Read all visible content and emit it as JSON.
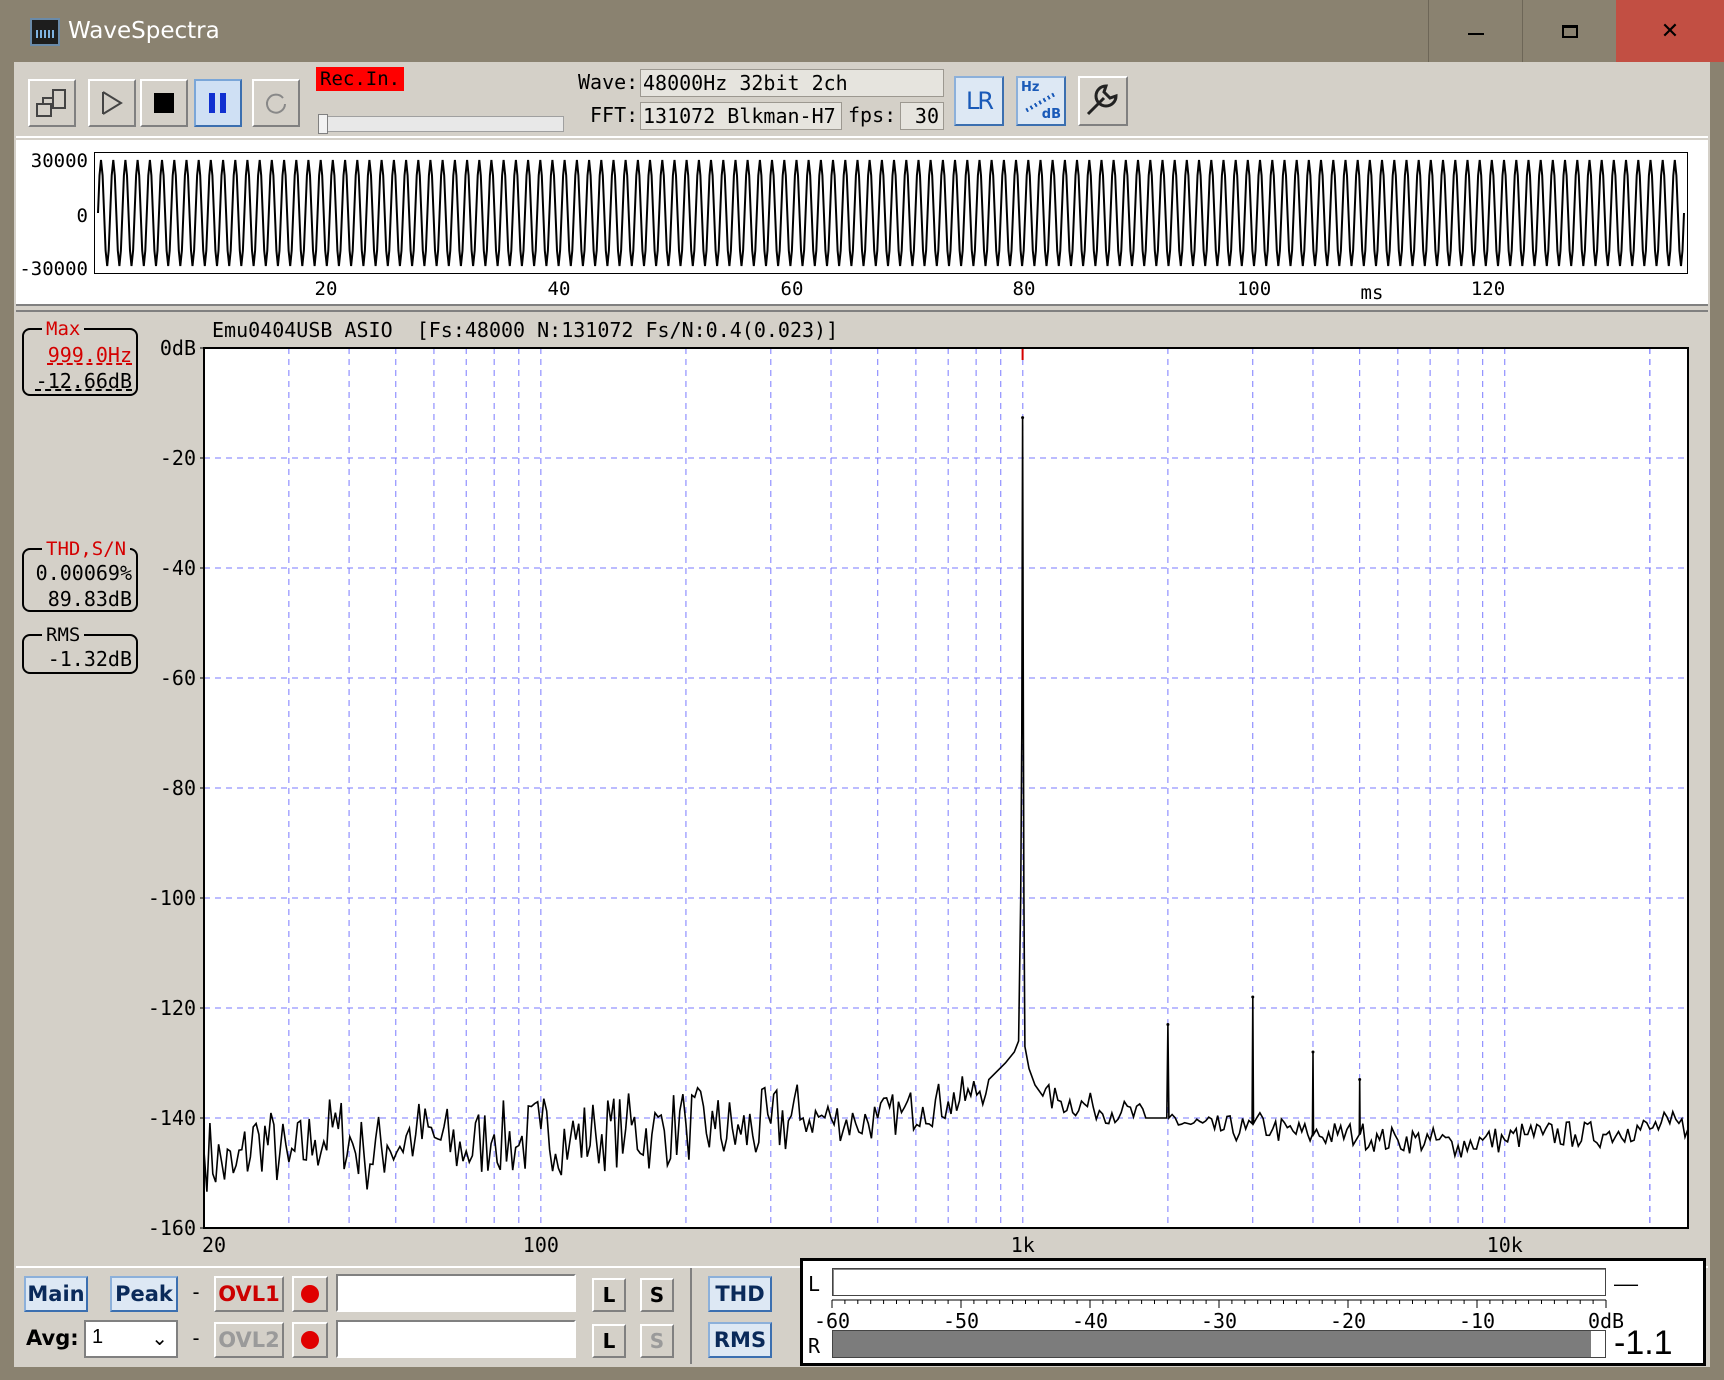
{
  "window": {
    "title": "WaveSpectra",
    "controls": {
      "minimize": "‒",
      "maximize": "▫",
      "close": "✕"
    }
  },
  "toolbar": {
    "rec_in_label": "Rec.In.",
    "wave_label": "Wave:",
    "wave_value": "48000Hz 32bit 2ch",
    "fft_label": "FFT:",
    "fft_value": "131072 Blkman-H7",
    "fps_label": "fps:",
    "fps_value": "30",
    "lr_icon_text": "LR",
    "hz_icon_top": "Hz",
    "hz_icon_bottom": "dB"
  },
  "waveform": {
    "y_labels": [
      "30000",
      "0",
      "-30000"
    ],
    "x_labels": [
      "20",
      "40",
      "60",
      "80",
      "100",
      "120"
    ],
    "x_unit": "ms",
    "cycles_visible": 130
  },
  "spectrum": {
    "header": "Emu0404USB ASIO  [Fs:48000 N:131072 Fs/N:0.4(0.023)]",
    "max_box": {
      "caption": "Max",
      "freq": "999.0Hz",
      "level": "-12.66dB"
    },
    "thd_box": {
      "caption": "THD,S/N",
      "thd": "0.00069%",
      "sn": "89.83dB"
    },
    "rms_box": {
      "caption": "RMS",
      "level": "-1.32dB"
    }
  },
  "chart_data": {
    "type": "line",
    "xlabel": "",
    "ylabel": "",
    "x_scale": "log",
    "xlim": [
      20,
      24000
    ],
    "ylim": [
      -160,
      0
    ],
    "y_ticks": [
      "0dB",
      "-20",
      "-40",
      "-60",
      "-80",
      "-100",
      "-120",
      "-140",
      "-160"
    ],
    "x_ticks": [
      "20",
      "100",
      "1k",
      "10k"
    ],
    "grid": true,
    "series": [
      {
        "x": [
          20,
          23,
          26,
          30,
          34,
          38,
          43,
          48,
          55,
          62,
          70,
          80,
          90,
          100,
          115,
          130,
          150,
          170,
          200,
          230,
          260,
          300,
          350,
          400,
          450,
          500,
          560,
          620,
          700,
          780,
          850,
          920,
          960,
          980,
          990,
          995,
          997,
          999,
          1001,
          1003,
          1005,
          1010,
          1030,
          1060,
          1100,
          1200,
          1400,
          1600,
          1800,
          1990,
          2000,
          2010,
          2200,
          2500,
          2900,
          2990,
          3000,
          3010,
          3300,
          3900,
          3990,
          4000,
          4010,
          4500,
          4990,
          5000,
          5010,
          5500,
          6000,
          7000,
          8000,
          9000,
          10000,
          11000,
          12000,
          14000,
          16000,
          18000,
          20000,
          22000,
          24000
        ],
        "y": [
          -146,
          -150,
          -143,
          -148,
          -144,
          -142,
          -147,
          -145,
          -143,
          -144,
          -146,
          -143,
          -145,
          -142,
          -144,
          -143,
          -142,
          -143,
          -141,
          -142,
          -143,
          -141,
          -140,
          -140,
          -141,
          -140,
          -139,
          -138,
          -137,
          -136,
          -133,
          -130,
          -128,
          -126,
          -100,
          -70,
          -40,
          -12.66,
          -40,
          -70,
          -100,
          -127,
          -131,
          -134,
          -136,
          -137,
          -138,
          -139,
          -140,
          -140,
          -123,
          -140,
          -141,
          -142,
          -142,
          -141,
          -118,
          -141,
          -142,
          -143,
          -143,
          -128,
          -143,
          -143,
          -143,
          -133,
          -143,
          -144,
          -144,
          -144,
          -145,
          -144,
          -144,
          -143,
          -143,
          -143,
          -143,
          -142,
          -142,
          -141,
          -142
        ]
      }
    ],
    "peaks": [
      {
        "x": 999,
        "y": -12.66
      },
      {
        "x": 2000,
        "y": -123
      },
      {
        "x": 3000,
        "y": -118
      },
      {
        "x": 4000,
        "y": -128
      },
      {
        "x": 5000,
        "y": -133
      }
    ]
  },
  "bottom": {
    "main_label": "Main",
    "peak_label": "Peak",
    "dash": "-",
    "ovl1_label": "OVL1",
    "ovl2_label": "OVL2",
    "l_label": "L",
    "s_label": "S",
    "thd_label": "THD",
    "rms_label": "RMS",
    "avg_label": "Avg:",
    "avg_value": "1"
  },
  "level_meter": {
    "left_label": "L",
    "right_label": "R",
    "scale": [
      "-60",
      "-50",
      "-40",
      "-30",
      "-20",
      "-10",
      "0dB"
    ],
    "left_level_db": -60,
    "right_level_db": -1.1,
    "right_readout": "-1.1",
    "left_readout": "——"
  },
  "colors": {
    "grid": "#7a7aff",
    "trace": "#000000",
    "accent_red": "#d40000",
    "rec_badge": "#ff0000"
  }
}
